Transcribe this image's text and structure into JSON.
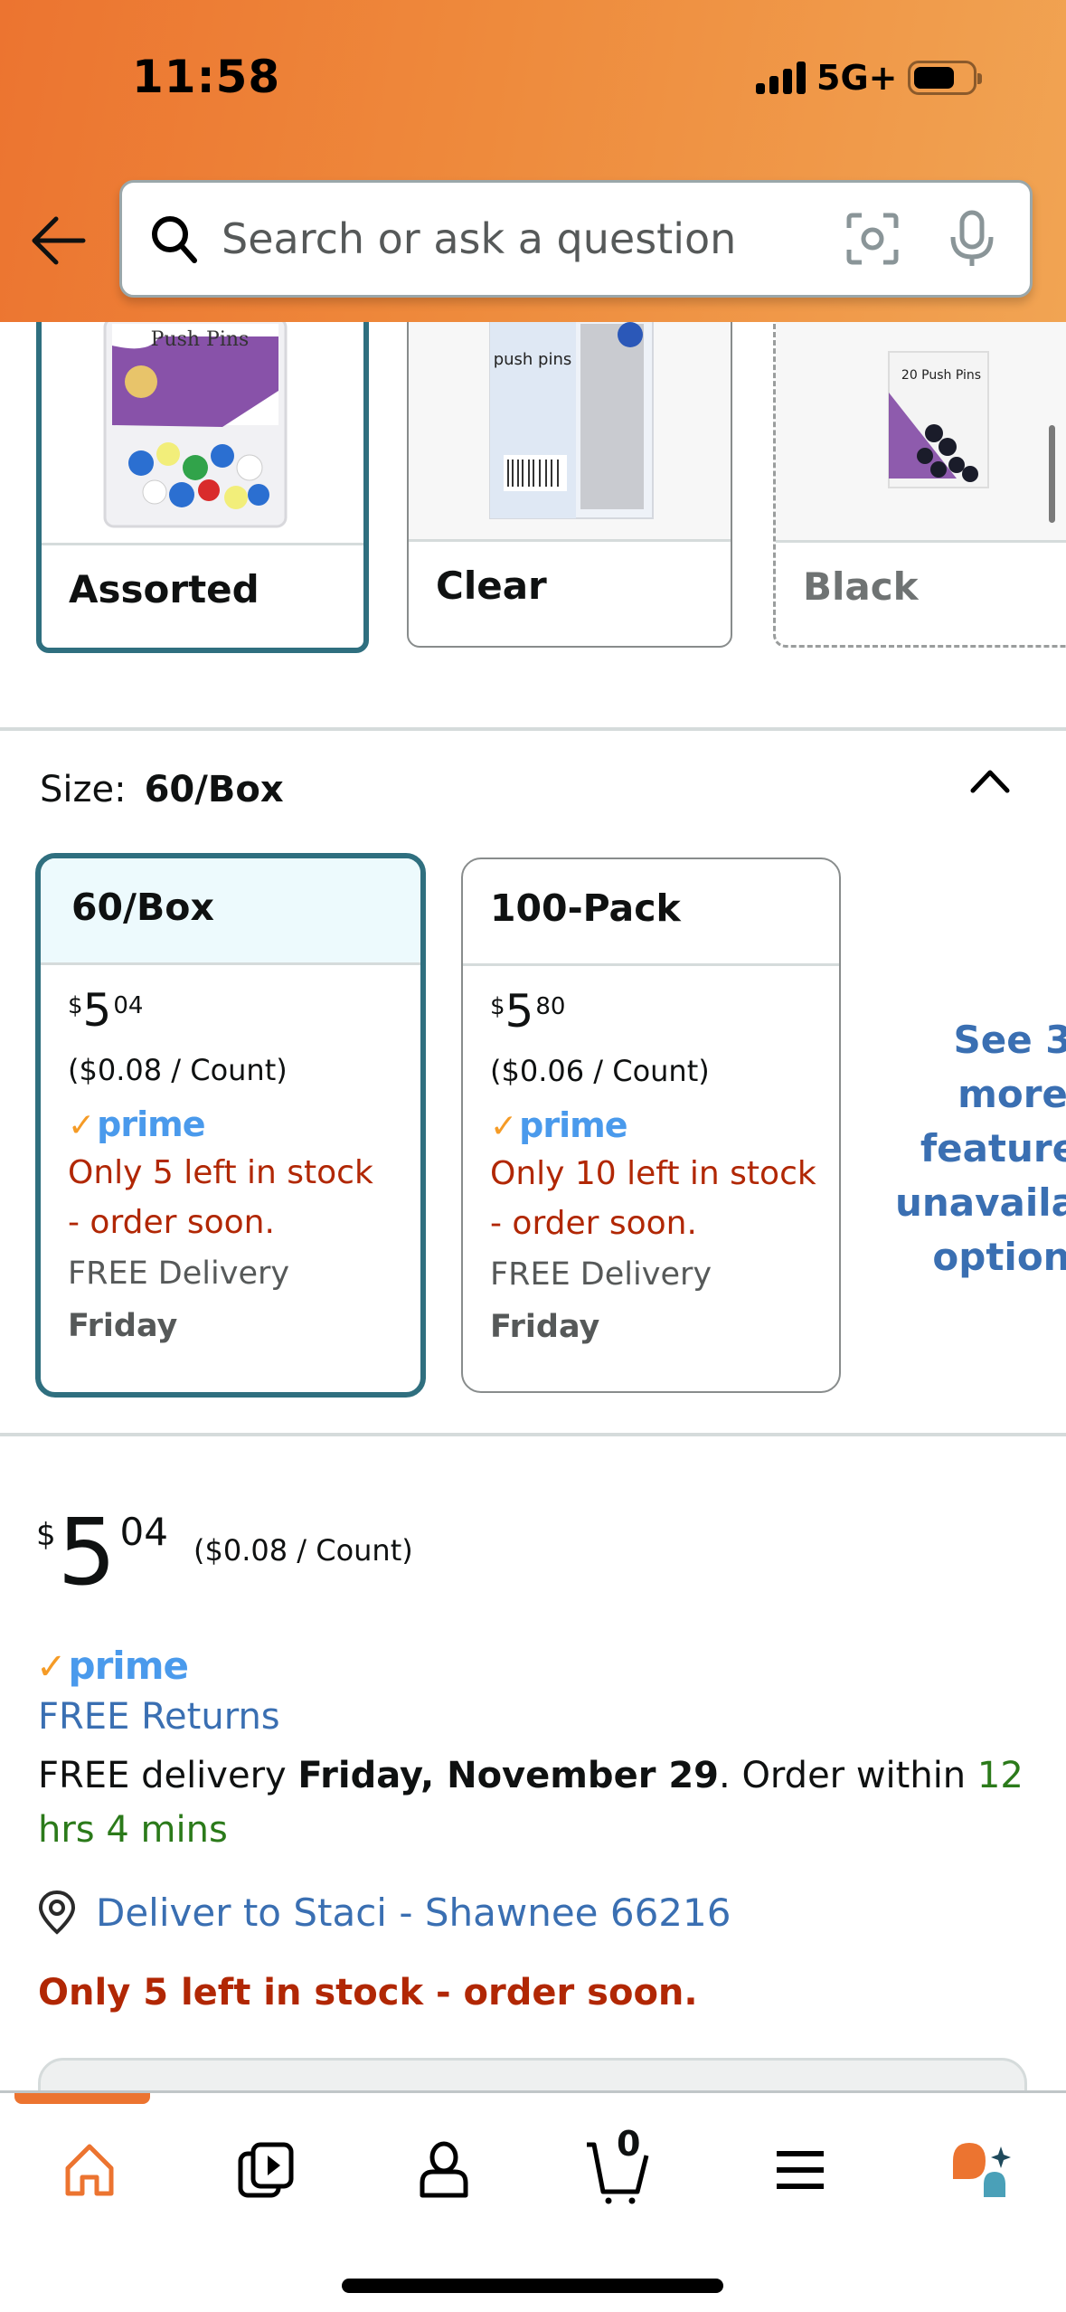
{
  "status_bar": {
    "time": "11:58",
    "network": "5G+",
    "signal_bars": 4,
    "battery_level_percent": 60
  },
  "header": {
    "back_icon": "arrow-left-icon",
    "search": {
      "placeholder": "Search or ask a question",
      "value": "",
      "icons": [
        "search-icon",
        "camera-icon",
        "microphone-icon"
      ]
    }
  },
  "colors": {
    "brand_orange": "#ec7430",
    "selected_border": "#2f6f7f",
    "link_blue": "#3a6fb2",
    "stock_red": "#b12704",
    "timer_green": "#2b7a1a",
    "prime_blue": "#4a9aec",
    "prime_check": "#f59b26"
  },
  "color_options": [
    {
      "label": "Assorted",
      "selected": true,
      "available": true,
      "image_text": "Push Pins"
    },
    {
      "label": "Clear",
      "selected": false,
      "available": true,
      "image_text": "push pins"
    },
    {
      "label": "Black",
      "selected": false,
      "available": false,
      "image_text": "20 Push Pins"
    }
  ],
  "size_section": {
    "label": "Size:",
    "selected_value": "60/Box",
    "collapse_icon": "chevron-up-icon",
    "options": [
      {
        "name": "60/Box",
        "selected": true,
        "price_symbol": "$",
        "price_whole": "5",
        "price_fraction": "04",
        "unit_price": "($0.08 / Count)",
        "prime": "prime",
        "stock_line1": "Only 5 left in stock",
        "stock_line2": "- order soon.",
        "delivery_label": "FREE Delivery",
        "delivery_day": "Friday"
      },
      {
        "name": "100-Pack",
        "selected": false,
        "price_symbol": "$",
        "price_whole": "5",
        "price_fraction": "80",
        "unit_price": "($0.06 / Count)",
        "prime": "prime",
        "stock_line1": "Only 10 left in stock",
        "stock_line2": "- order soon.",
        "delivery_label": "FREE Delivery",
        "delivery_day": "Friday"
      }
    ],
    "see_more": [
      "See 3 more",
      "featured",
      "unavailable",
      "options"
    ]
  },
  "buy_box": {
    "price_symbol": "$",
    "price_whole": "5",
    "price_fraction": "04",
    "unit_price": "($0.08 / Count)",
    "prime": "prime",
    "free_returns": "FREE Returns",
    "delivery_prefix": "FREE delivery ",
    "delivery_date": "Friday, November 29",
    "delivery_middle": ". Order within ",
    "order_within": "12 hrs 4 mins",
    "deliver_to": "Deliver to Staci - Shawnee 66216",
    "stock_message": "Only 5 left in stock - order soon."
  },
  "tab_bar": {
    "active": "home",
    "cart_count": "0",
    "tabs": [
      {
        "name": "home",
        "icon": "home-icon"
      },
      {
        "name": "video",
        "icon": "video-icon"
      },
      {
        "name": "account",
        "icon": "person-icon"
      },
      {
        "name": "cart",
        "icon": "cart-icon"
      },
      {
        "name": "menu",
        "icon": "menu-icon"
      },
      {
        "name": "rufus",
        "icon": "ai-assistant-icon"
      }
    ]
  }
}
